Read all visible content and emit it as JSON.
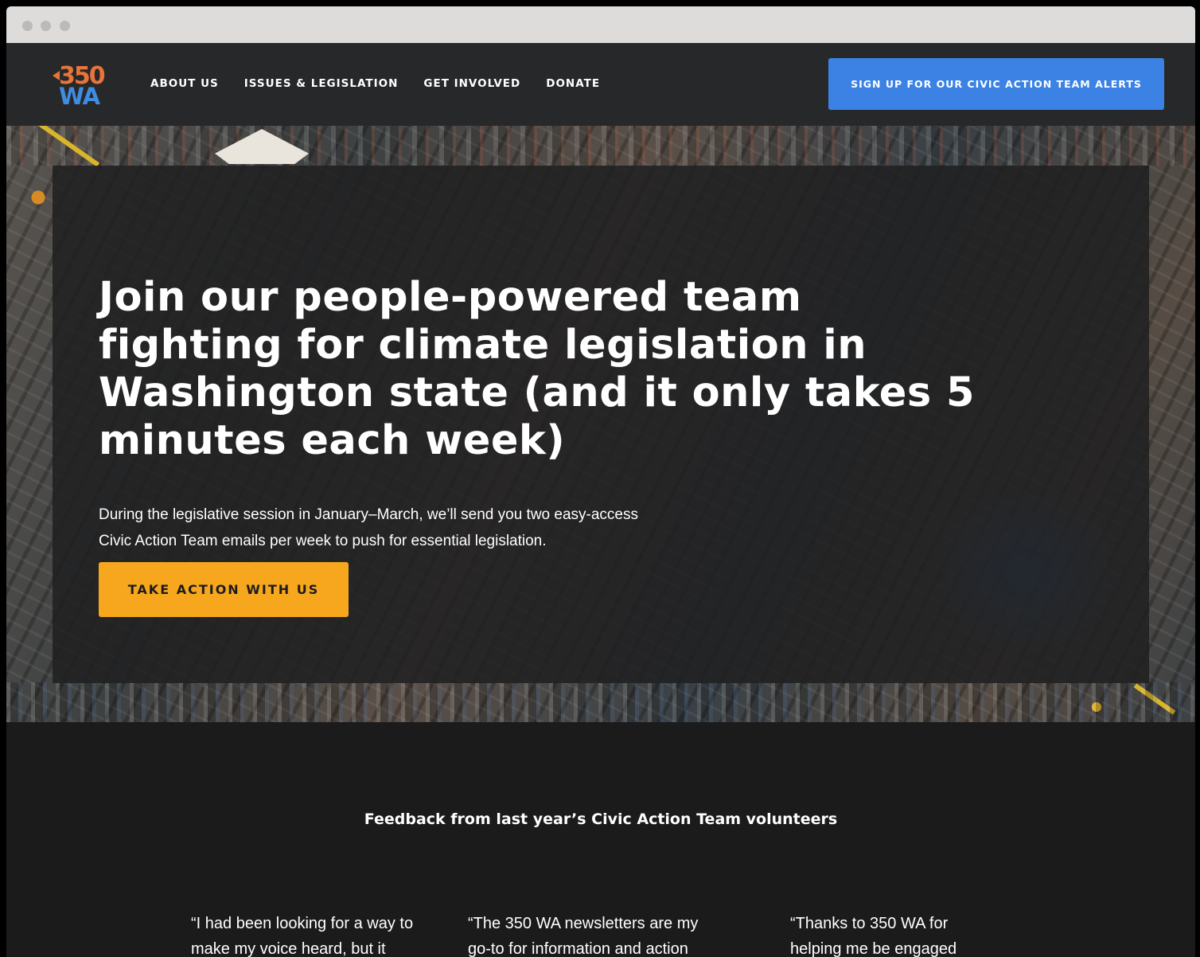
{
  "brand": {
    "logo_top": "350",
    "logo_bottom": "WA",
    "orange": "#e8743b",
    "blue": "#3f8de0"
  },
  "nav": {
    "items": [
      {
        "label": "ABOUT US"
      },
      {
        "label": "ISSUES & LEGISLATION"
      },
      {
        "label": "GET INVOLVED"
      },
      {
        "label": "DONATE"
      }
    ],
    "signup_label": "SIGN UP FOR OUR CIVIC ACTION TEAM ALERTS",
    "signup_color": "#3b82e4"
  },
  "hero": {
    "title": "Join our people-powered team fighting for climate legislation in Washington state (and it only takes 5 minutes each week)",
    "body": "During the legislative session in January–March, we’ll send you two easy-access Civic Action Team emails per week to push for essential legislation.",
    "cta_label": "TAKE ACTION WITH US",
    "cta_color": "#f6a71e"
  },
  "feedback": {
    "heading": "Feedback from last year’s Civic Action Team volunteers",
    "quotes": [
      {
        "text": "“I had been looking for a way to make my voice heard, but it"
      },
      {
        "text": "“The 350 WA newsletters are my go-to for information and action"
      },
      {
        "text": "“Thanks to 350 WA for helping me be engaged"
      }
    ]
  }
}
